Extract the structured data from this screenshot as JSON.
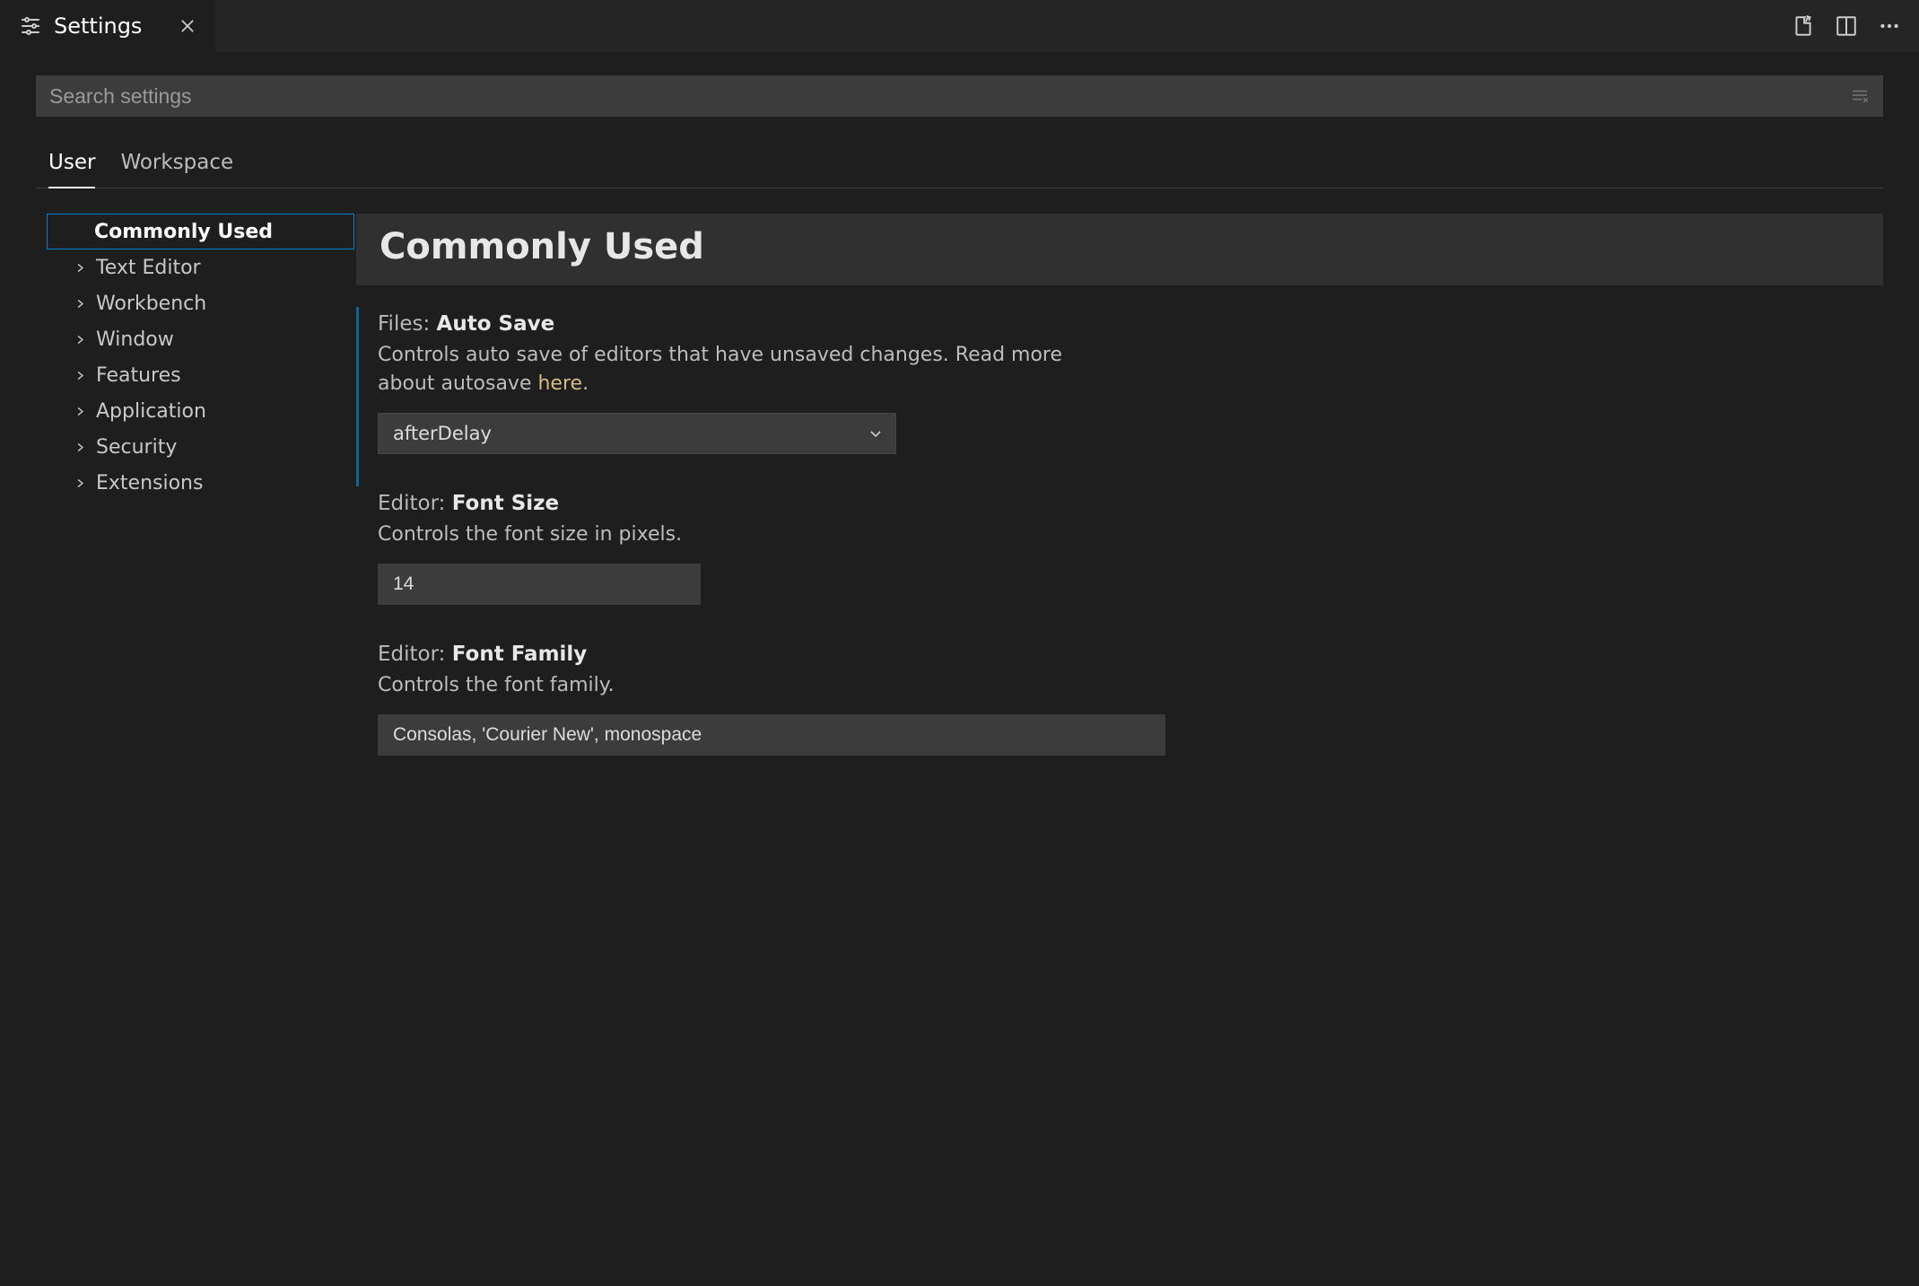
{
  "tab": {
    "title": "Settings"
  },
  "search": {
    "placeholder": "Search settings"
  },
  "scope_tabs": {
    "user": "User",
    "workspace": "Workspace"
  },
  "toc": {
    "items": [
      {
        "label": "Commonly Used",
        "expandable": false,
        "selected": true
      },
      {
        "label": "Text Editor",
        "expandable": true,
        "selected": false
      },
      {
        "label": "Workbench",
        "expandable": true,
        "selected": false
      },
      {
        "label": "Window",
        "expandable": true,
        "selected": false
      },
      {
        "label": "Features",
        "expandable": true,
        "selected": false
      },
      {
        "label": "Application",
        "expandable": true,
        "selected": false
      },
      {
        "label": "Security",
        "expandable": true,
        "selected": false
      },
      {
        "label": "Extensions",
        "expandable": true,
        "selected": false
      }
    ]
  },
  "group_header": "Commonly Used",
  "settings": {
    "autoSave": {
      "prefix": "Files: ",
      "name": "Auto Save",
      "desc_a": "Controls auto save of editors that have unsaved changes. Read more about autosave ",
      "link": "here",
      "desc_b": ".",
      "value": "afterDelay"
    },
    "fontSize": {
      "prefix": "Editor: ",
      "name": "Font Size",
      "desc": "Controls the font size in pixels.",
      "value": "14"
    },
    "fontFamily": {
      "prefix": "Editor: ",
      "name": "Font Family",
      "desc": "Controls the font family.",
      "value": "Consolas, 'Courier New', monospace"
    }
  }
}
